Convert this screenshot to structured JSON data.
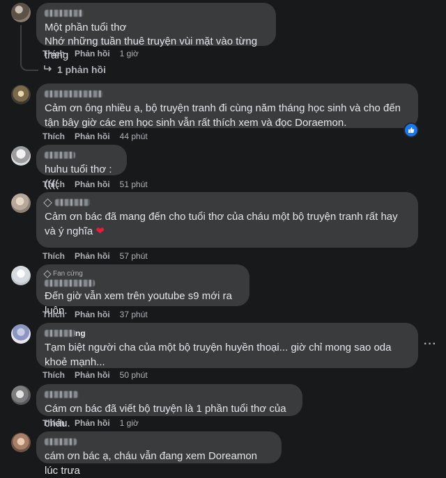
{
  "actions": {
    "like": "Thích",
    "reply": "Phản hồi"
  },
  "comments": [
    {
      "text": "Một phần tuổi thơ\nNhớ những tuần thuê truyện vùi mặt vào từng trang",
      "time": "1 giờ",
      "replies_label": "1 phản hồi"
    },
    {
      "text": "Cảm ơn ông nhiều ạ, bộ truyện tranh đi cùng năm tháng học sinh và cho đến tận bây giờ các em học sinh vẫn rất thích xem và đọc Doraemon.",
      "time": "44 phút"
    },
    {
      "text": "huhu tuổi thơ :((((",
      "time": "51 phút"
    },
    {
      "text": "Cảm ơn bác đã mang đến cho tuổi thơ của cháu một bộ truyện tranh rất hay và ý nghĩa",
      "emoji": "❤",
      "time": "57 phút"
    },
    {
      "badge": "Fan cứng",
      "text": "Đến giờ vẫn xem trên youtube s9 mới ra luôn.",
      "time": "37 phút"
    },
    {
      "name_suffix": "ng",
      "text": "Tạm biệt người cha của một bộ truyện huyền thoại... giờ chỉ mong sao oda khoẻ mạnh...",
      "time": "50 phút"
    },
    {
      "text": "Cám ơn bác đã viết bộ truyện là 1 phần tuổi thơ của cháu.",
      "time": "1 giờ"
    },
    {
      "text": "cám ơn bác ạ, cháu vẫn đang xem Doreamon lúc trưa"
    }
  ],
  "colors": {
    "background": "#18191a",
    "bubble": "#3a3b3c",
    "text": "#e4e6eb",
    "muted": "#b0b3b8",
    "like": "#1877f2",
    "heart": "#e41e3f"
  },
  "icons": [
    "reply-arrow-icon",
    "like-reaction-icon",
    "heart-emoji-icon",
    "more-options-icon",
    "diamond-badge-icon"
  ]
}
